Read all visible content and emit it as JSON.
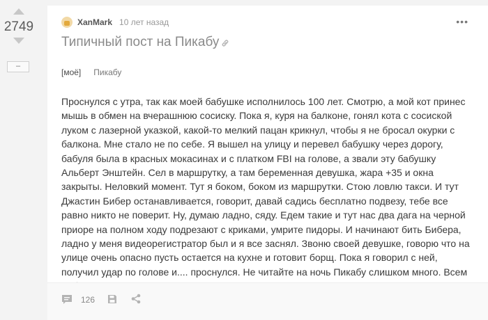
{
  "vote": {
    "rating": "2749",
    "hide_label": "–"
  },
  "post": {
    "author": "XanMark",
    "time": "10 лет назад",
    "title": "Типичный пост на Пикабу",
    "tags": [
      "[моё]",
      "Пикабу"
    ],
    "body": "Проснулся с утра, так как моей бабушке исполнилось 100 лет. Смотрю, а мой кот принес мышь в обмен на вчерашнюю сосиску. Пока я, куря на балконе, гонял кота с сосиской луком с лазерной указкой, какой-то мелкий пацан крикнул, чтобы я не бросал окурки с балкона. Мне стало не по себе. Я вышел на улицу и перевел бабушку через дорогу, бабуля была в красных мокасинах и с платком FBI на голове, а звали эту бабушку Альберт Энштейн. Сел в маршрутку, а там беременная девушка, жара +35 и окна закрыты. Неловкий момент. Тут я боком, боком из маршрутки. Стою ловлю такси. И тут Джастин Бибер останавливается, говорит, давай садись бесплатно подвезу, тебе все равно никто не поверит. Ну, думаю ладно, сяду. Едем такие и тут нас два дага на черной приоре на полном ходу подрезают с криками, умрите пидоры. И начинают бить Бибера, ладно у меня видеорегистратор был и я все заснял. Звоню своей девушке, говорю что на улице очень опасно пусть остается на кухне и готовит борщ. Пока я говорил с ней, получил удар по голове и.... проснулся. Не читайте на ночь Пикабу слишком много. Всем добра! :)",
    "comments_count": "126"
  },
  "icons": {
    "vote_up": "triangle-up-icon",
    "vote_down": "triangle-down-icon",
    "more": "more-dots-icon",
    "link": "link-icon",
    "comments": "comment-icon",
    "save": "save-icon",
    "share": "share-icon"
  },
  "colors": {
    "background": "#f3f3f3",
    "card": "#ffffff",
    "footer": "#f9f9f9",
    "title": "#8a8a8a",
    "icon": "#b3b3b3"
  }
}
